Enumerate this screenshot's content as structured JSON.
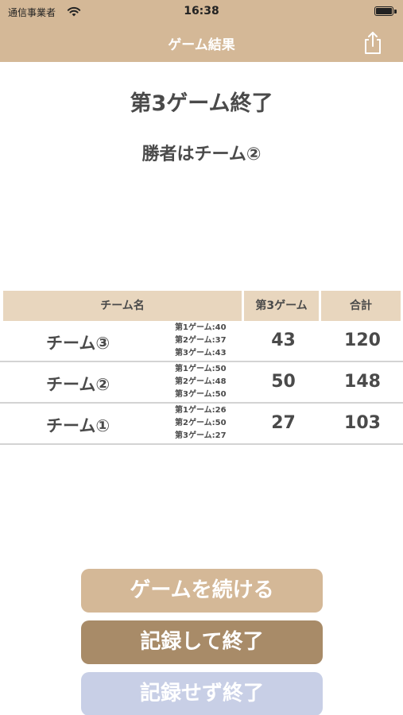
{
  "status_bar": {
    "carrier": "通信事業者",
    "time": "16:38"
  },
  "nav": {
    "title": "ゲーム結果",
    "share_icon": "share-icon"
  },
  "result": {
    "heading": "第3ゲーム終了",
    "winner": "勝者はチーム②"
  },
  "table": {
    "headers": {
      "name": "チーム名",
      "current_game": "第3ゲーム",
      "total": "合計"
    },
    "rows": [
      {
        "team": "チーム③",
        "history": [
          "第1ゲーム:40",
          "第2ゲーム:37",
          "第3ゲーム:43"
        ],
        "current": "43",
        "total": "120"
      },
      {
        "team": "チーム②",
        "history": [
          "第1ゲーム:50",
          "第2ゲーム:48",
          "第3ゲーム:50"
        ],
        "current": "50",
        "total": "148"
      },
      {
        "team": "チーム①",
        "history": [
          "第1ゲーム:26",
          "第2ゲーム:50",
          "第3ゲーム:27"
        ],
        "current": "27",
        "total": "103"
      }
    ]
  },
  "buttons": {
    "continue": "ゲームを続ける",
    "save_and_end": "記録して終了",
    "end_without_save": "記録せず終了"
  },
  "colors": {
    "accent": "#d4b897",
    "header_bg": "#e8d6be",
    "save_button": "#a88b68",
    "nosave_button": "#c8cfe6",
    "text": "#4a4a4a"
  }
}
